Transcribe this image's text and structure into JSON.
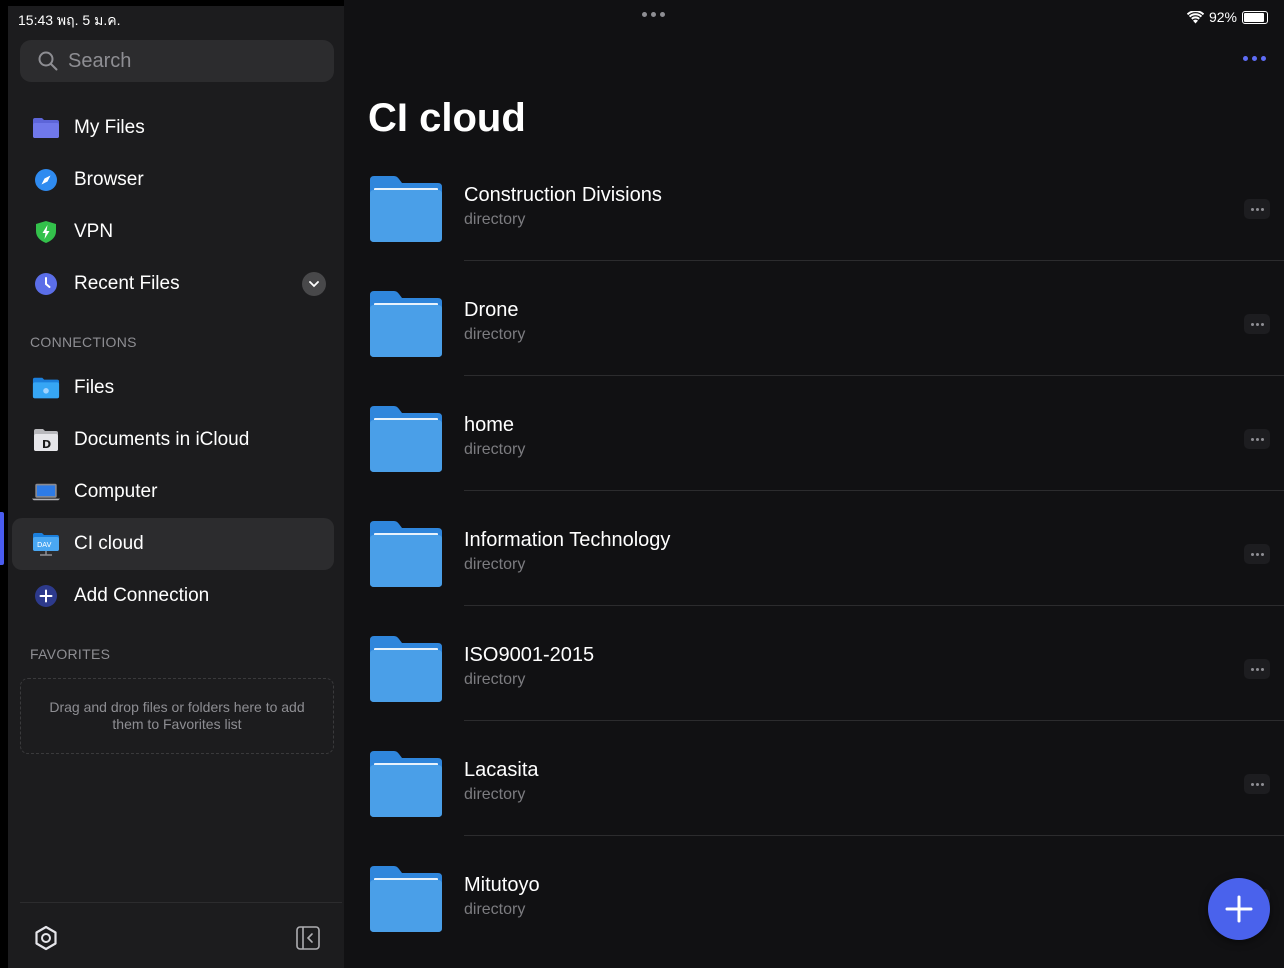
{
  "status_bar": {
    "time": "15:43  พฤ. 5 ม.ค.",
    "battery": "92%",
    "battery_level": 0.92
  },
  "sidebar": {
    "search_placeholder": "Search",
    "top_items": [
      {
        "label": "My Files",
        "icon": "folder-icon"
      },
      {
        "label": "Browser",
        "icon": "compass-icon"
      },
      {
        "label": "VPN",
        "icon": "shield-icon"
      },
      {
        "label": "Recent Files",
        "icon": "clock-icon"
      }
    ],
    "connections_header": "CONNECTIONS",
    "connections": [
      {
        "label": "Files",
        "icon": "files-folder-icon"
      },
      {
        "label": "Documents in iCloud",
        "icon": "documents-app-icon"
      },
      {
        "label": "Computer",
        "icon": "laptop-icon"
      },
      {
        "label": "CI cloud",
        "icon": "dav-server-icon",
        "selected": true
      },
      {
        "label": "Add Connection",
        "icon": "plus-icon"
      }
    ],
    "favorites_header": "FAVORITES",
    "favorites_hint": "Drag and drop files or folders here to add them to Favorites list"
  },
  "main": {
    "title": "CI cloud",
    "items": [
      {
        "name": "Construction Divisions",
        "type": "directory"
      },
      {
        "name": "Drone",
        "type": "directory"
      },
      {
        "name": "home",
        "type": "directory"
      },
      {
        "name": "Information Technology",
        "type": "directory"
      },
      {
        "name": "ISO9001-2015",
        "type": "directory"
      },
      {
        "name": "Lacasita",
        "type": "directory"
      },
      {
        "name": "Mitutoyo",
        "type": "directory"
      }
    ]
  },
  "colors": {
    "accent": "#4a62ec",
    "sidebar_bg": "#1c1c1e",
    "main_bg": "#111113",
    "folder_blue": "#4a9fe8"
  }
}
